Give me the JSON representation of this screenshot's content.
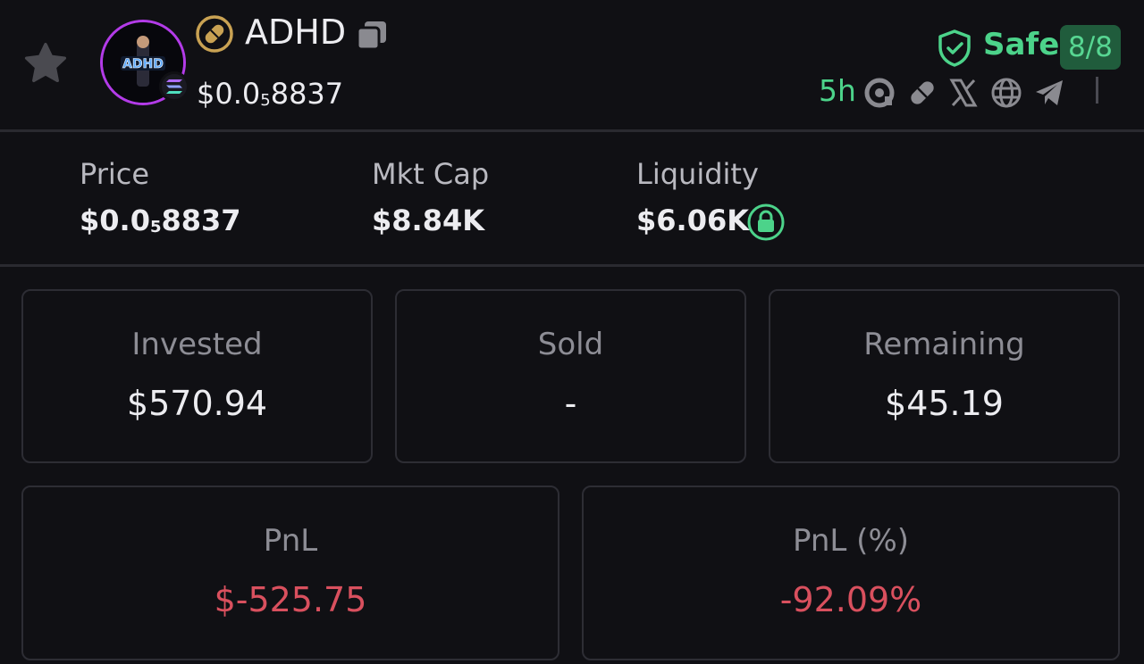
{
  "header": {
    "token_name": "ADHD",
    "avatar_text": "ADHD",
    "price_prefix": "$0.0",
    "price_sub": "5",
    "price_suffix": "8837",
    "safety_label": "Safe",
    "safety_score": "8/8",
    "age": "5h",
    "social_icons": [
      "pump-icon",
      "pill-icon",
      "x-icon",
      "globe-icon",
      "telegram-icon"
    ]
  },
  "stats": {
    "price": {
      "label": "Price",
      "prefix": "$0.0",
      "sub": "5",
      "suffix": "8837"
    },
    "market_cap": {
      "label": "Mkt Cap",
      "value": "$8.84K"
    },
    "liquidity": {
      "label": "Liquidity",
      "value": "$6.06K"
    }
  },
  "cards": {
    "invested": {
      "label": "Invested",
      "value": "$570.94"
    },
    "sold": {
      "label": "Sold",
      "value": "-"
    },
    "remaining": {
      "label": "Remaining",
      "value": "$45.19"
    },
    "pnl": {
      "label": "PnL",
      "value": "$-525.75"
    },
    "pnl_pct": {
      "label": "PnL (%)",
      "value": "-92.09%"
    }
  },
  "colors": {
    "background": "#101014",
    "safe_green": "#4cd38a",
    "negative_red": "#d9505e",
    "avatar_ring": "#b33be8"
  }
}
